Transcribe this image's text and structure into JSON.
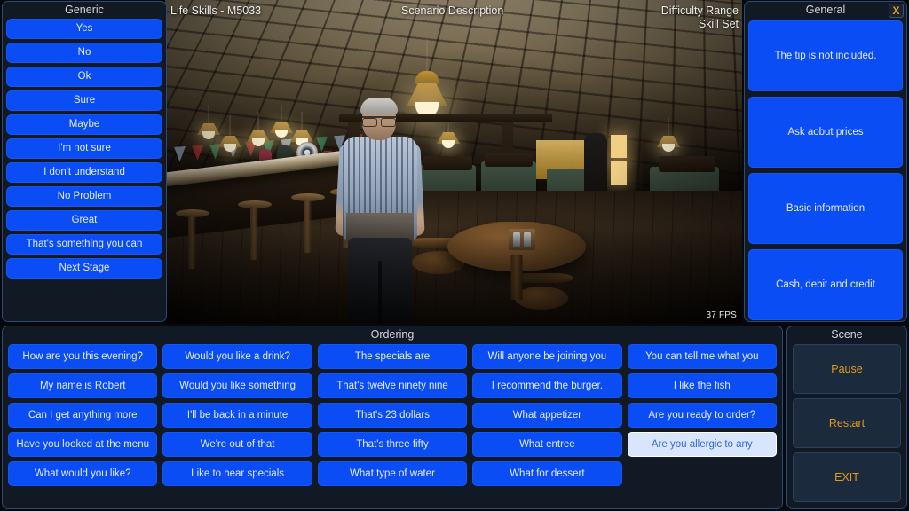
{
  "header": {
    "title": "Life Skills - M5033",
    "scenario_label": "Scenario Description",
    "difficulty_label": "Difficulty Range",
    "skillset_label": "Skill Set",
    "fps": "37 FPS"
  },
  "generic_panel": {
    "title": "Generic",
    "buttons": [
      "Yes",
      "No",
      "Ok",
      "Sure",
      "Maybe",
      "I'm not sure",
      "I don't understand",
      "No Problem",
      "Great",
      "That's something you can",
      "Next Stage"
    ]
  },
  "general_panel": {
    "title": "General",
    "close_label": "X",
    "buttons": [
      "The tip is not included.",
      "Ask aobut prices",
      "Basic information",
      "Cash, debit and credit"
    ]
  },
  "ordering_panel": {
    "title": "Ordering",
    "buttons": [
      {
        "label": "How are you this evening?",
        "selected": false
      },
      {
        "label": "Would you like a drink?",
        "selected": false
      },
      {
        "label": "The specials are",
        "selected": false
      },
      {
        "label": "Will anyone be joining you",
        "selected": false
      },
      {
        "label": "You can tell me what you",
        "selected": false
      },
      {
        "label": "My name is Robert",
        "selected": false
      },
      {
        "label": "Would you like something",
        "selected": false
      },
      {
        "label": "That's twelve ninety nine",
        "selected": false
      },
      {
        "label": "I recommend the burger.",
        "selected": false
      },
      {
        "label": "I like the fish",
        "selected": false
      },
      {
        "label": "Can I get anything more",
        "selected": false
      },
      {
        "label": "I'll be back in a minute",
        "selected": false
      },
      {
        "label": "That's 23 dollars",
        "selected": false
      },
      {
        "label": "What appetizer",
        "selected": false
      },
      {
        "label": "Are you ready to order?",
        "selected": false
      },
      {
        "label": "Have you looked at the menu",
        "selected": false
      },
      {
        "label": "We're out of that",
        "selected": false
      },
      {
        "label": "That's three fifty",
        "selected": false
      },
      {
        "label": "What entree",
        "selected": false
      },
      {
        "label": "Are you allergic to any",
        "selected": true
      },
      {
        "label": "What would you like?",
        "selected": false
      },
      {
        "label": "Like to hear specials",
        "selected": false
      },
      {
        "label": "What type of water",
        "selected": false
      },
      {
        "label": "What for dessert",
        "selected": false
      }
    ]
  },
  "scene_panel": {
    "title": "Scene",
    "buttons": [
      "Pause",
      "Restart",
      "EXIT"
    ]
  },
  "colors": {
    "button_blue": "#0b4df5",
    "button_selected_bg": "#d8e5fb",
    "button_selected_text": "#2f6bdd",
    "panel_bg": "#111924",
    "panel_border": "#2c4a74",
    "accent_gold": "#e09b1a",
    "title_text": "#d3d7dc"
  },
  "scene_elements": {
    "setting": "restaurant-bar-interior",
    "character": "waiter-npc"
  }
}
